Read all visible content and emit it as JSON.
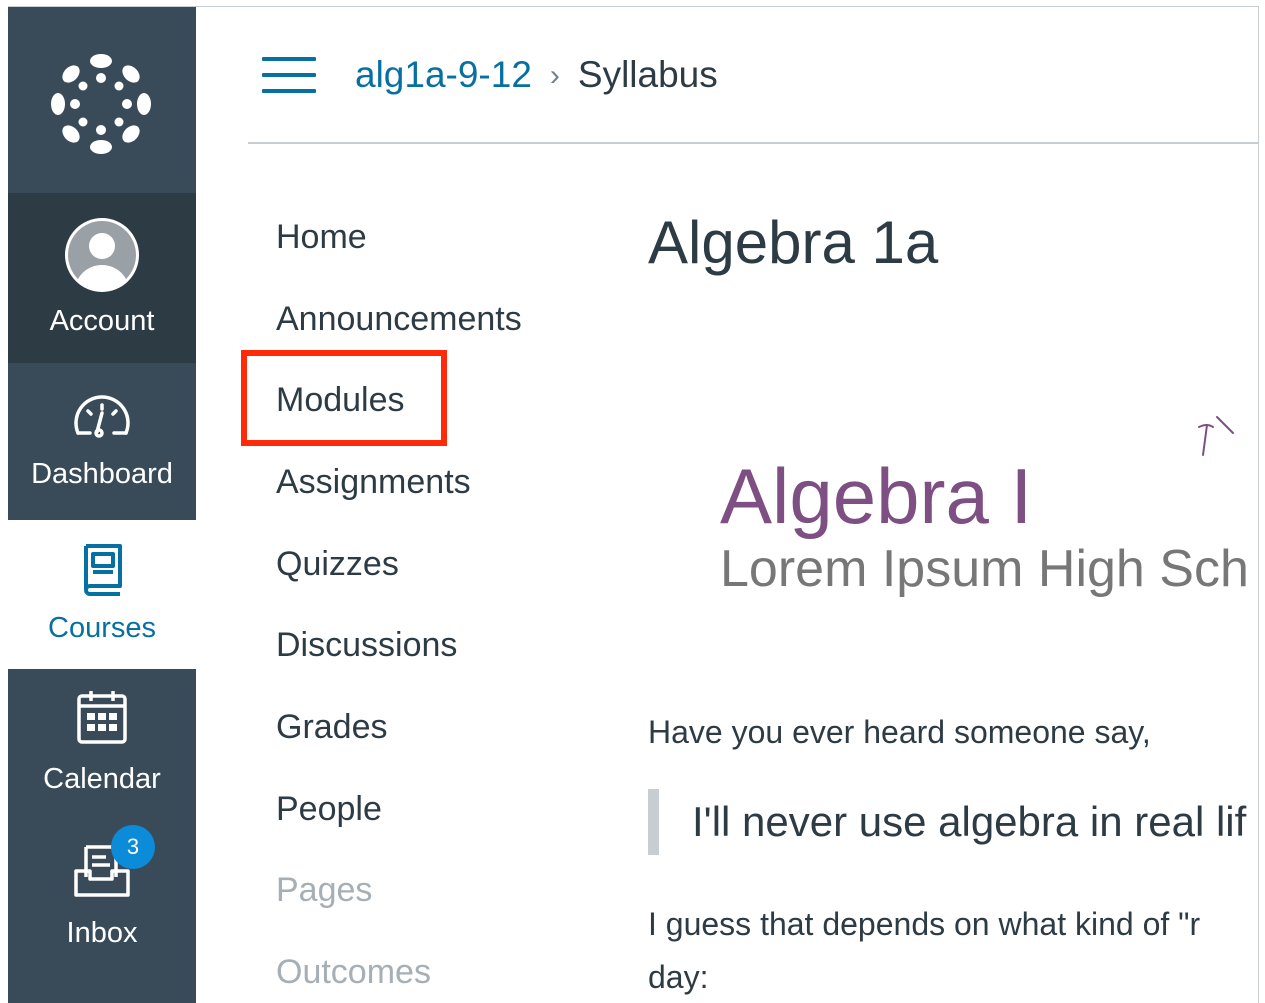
{
  "global_nav": {
    "logo_icon": "canvas-logo-icon",
    "items": [
      {
        "label": "Account",
        "icon": "avatar-icon"
      },
      {
        "label": "Dashboard",
        "icon": "speedometer-icon"
      },
      {
        "label": "Courses",
        "icon": "book-icon",
        "active": true
      },
      {
        "label": "Calendar",
        "icon": "calendar-icon"
      },
      {
        "label": "Inbox",
        "icon": "inbox-icon",
        "badge": "3"
      }
    ],
    "colors": {
      "background": "#394b58",
      "account_bg": "#2d3b45",
      "active_text": "#0770a3",
      "badge": "#0b8bd8"
    }
  },
  "header": {
    "breadcrumb_course": "alg1a-9-12",
    "breadcrumb_separator": "›",
    "breadcrumb_current": "Syllabus",
    "menu_icon": "hamburger-icon"
  },
  "course_nav": {
    "items": [
      {
        "label": "Home",
        "enabled": true
      },
      {
        "label": "Announcements",
        "enabled": true
      },
      {
        "label": "Modules",
        "enabled": true,
        "highlighted": true
      },
      {
        "label": "Assignments",
        "enabled": true
      },
      {
        "label": "Quizzes",
        "enabled": true
      },
      {
        "label": "Discussions",
        "enabled": true
      },
      {
        "label": "Grades",
        "enabled": true
      },
      {
        "label": "People",
        "enabled": true
      },
      {
        "label": "Pages",
        "enabled": false
      },
      {
        "label": "Outcomes",
        "enabled": false
      }
    ],
    "highlight_color": "#ff2a0a"
  },
  "content": {
    "title": "Algebra 1a",
    "banner": {
      "title": "Algebra I",
      "subtitle": "Lorem Ipsum High Sch"
    },
    "intro": "Have you ever heard someone say,",
    "quote": "I'll never use algebra in real lif",
    "followup_line1": "I guess that depends on what kind of \"r",
    "followup_line2": "day:"
  }
}
